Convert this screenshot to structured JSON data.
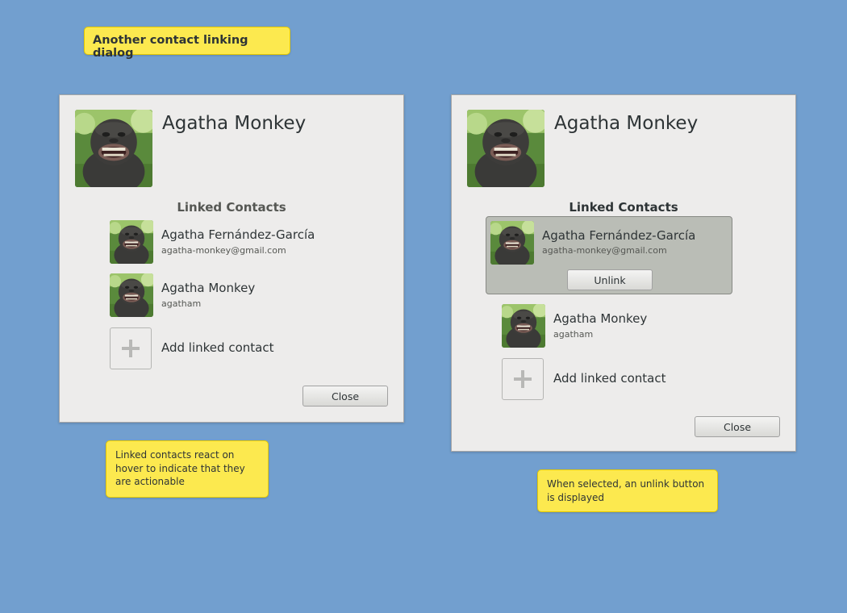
{
  "page": {
    "title_note": "Another contact linking dialog",
    "note_hover": "Linked contacts react on hover to indicate that they are actionable",
    "note_selected": "When selected, an unlink button is displayed"
  },
  "dialog_left": {
    "contact_name": "Agatha Monkey",
    "section_title": "Linked Contacts",
    "linked": [
      {
        "name": "Agatha Fernández-García",
        "sub": "agatha-monkey@gmail.com"
      },
      {
        "name": "Agatha Monkey",
        "sub": "agatham"
      }
    ],
    "add_label": "Add linked contact",
    "close_label": "Close"
  },
  "dialog_right": {
    "contact_name": "Agatha Monkey",
    "section_title": "Linked Contacts",
    "linked": [
      {
        "name": "Agatha Fernández-García",
        "sub": "agatha-monkey@gmail.com",
        "selected": true
      },
      {
        "name": "Agatha Monkey",
        "sub": "agatham"
      }
    ],
    "unlink_label": "Unlink",
    "add_label": "Add linked contact",
    "close_label": "Close"
  },
  "colors": {
    "background": "#729fcf",
    "note": "#fce94f",
    "dialog": "#edeceb",
    "selected_row": "#babdb6"
  },
  "icons": {
    "avatar": "monkey-photo-avatar",
    "add": "plus-icon"
  }
}
